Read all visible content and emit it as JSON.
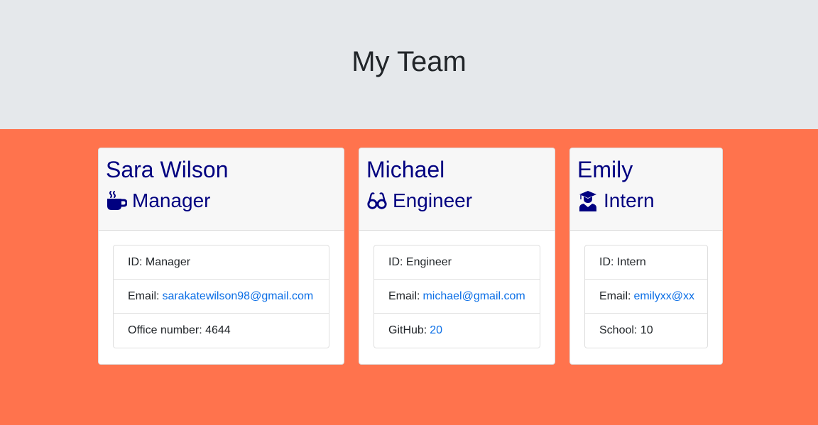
{
  "header": {
    "title": "My Team"
  },
  "colors": {
    "header_bg": "#e5e8eb",
    "body_bg": "#ff734d",
    "name_color": "#000080",
    "link_color": "#0a6ee6"
  },
  "cards": [
    {
      "name": "Sara Wilson",
      "role": "Manager",
      "role_icon": "coffee-mug-icon",
      "id_label": "ID: Manager",
      "email_label": "Email:",
      "email": "sarakatewilson98@gmail.com",
      "extra_label": "Office number: 4644"
    },
    {
      "name": "Michael",
      "role": "Engineer",
      "role_icon": "glasses-icon",
      "id_label": "ID: Engineer",
      "email_label": "Email:",
      "email": "michael@gmail.com",
      "extra_label": "GitHub:",
      "extra_link": "20"
    },
    {
      "name": "Emily",
      "role": "Intern",
      "role_icon": "graduate-icon",
      "id_label": "ID: Intern",
      "email_label": "Email:",
      "email": "emilyxx@xx",
      "extra_label": "School: 10"
    }
  ]
}
